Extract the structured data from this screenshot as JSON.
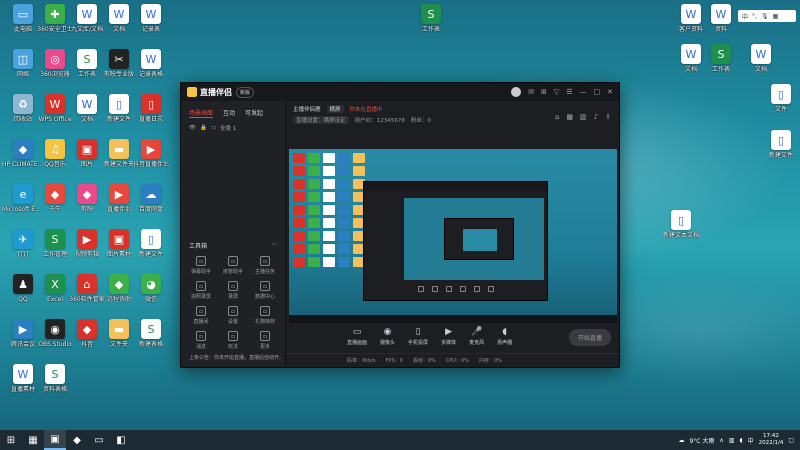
{
  "desktop": {
    "left_icons": [
      {
        "label": "此电脑",
        "icon": "computer-icon",
        "color": "#4aa3df"
      },
      {
        "label": "360安全卫士",
        "icon": "shield-icon",
        "color": "#3bb04a"
      },
      {
        "label": "九文库/文档",
        "icon": "doc-icon",
        "color": "#ffffff"
      },
      {
        "label": "文档",
        "icon": "doc-icon",
        "color": "#ffffff"
      },
      {
        "label": "记录表",
        "icon": "doc-icon",
        "color": "#ffffff"
      },
      {
        "label": "网络",
        "icon": "network-icon",
        "color": "#4aa3df"
      },
      {
        "label": "360浏览器",
        "icon": "browser-icon",
        "color": "#e84a8c"
      },
      {
        "label": "工作表",
        "icon": "sheet-icon",
        "color": "#ffffff"
      },
      {
        "label": "剪映专业版",
        "icon": "capcut-icon",
        "color": "#222222"
      },
      {
        "label": "记录表格",
        "icon": "doc-icon",
        "color": "#ffffff"
      },
      {
        "label": "回收站",
        "icon": "recycle-bin-icon",
        "color": "#8fb6cf"
      },
      {
        "label": "WPS Office",
        "icon": "wps-icon",
        "color": "#d9322b"
      },
      {
        "label": "文档",
        "icon": "doc-icon",
        "color": "#ffffff"
      },
      {
        "label": "新建文件",
        "icon": "file-icon",
        "color": "#ffffff"
      },
      {
        "label": "直播日志",
        "icon": "file-icon",
        "color": "#d9322b"
      },
      {
        "label": "HP CLIMATE User",
        "icon": "app-icon",
        "color": "#2c7fc0"
      },
      {
        "label": "QQ音乐",
        "icon": "music-icon",
        "color": "#f5c342"
      },
      {
        "label": "图片",
        "icon": "image-icon",
        "color": "#d9322b"
      },
      {
        "label": "新建文件夹",
        "icon": "folder-icon",
        "color": "#f3c05a"
      },
      {
        "label": "抖音直播伴侣",
        "icon": "live-icon",
        "color": "#e8473b"
      },
      {
        "label": "Microsoft Edge",
        "icon": "edge-icon",
        "color": "#1f9bd1"
      },
      {
        "label": "千牛",
        "icon": "app-icon",
        "color": "#e8473b"
      },
      {
        "label": "剪映",
        "icon": "app-icon",
        "color": "#e84a8c"
      },
      {
        "label": "直播伴侣",
        "icon": "live-icon",
        "color": "#e8473b"
      },
      {
        "label": "百度网盘",
        "icon": "cloud-icon",
        "color": "#2c7fc0"
      },
      {
        "label": "钉钉",
        "icon": "dingtalk-icon",
        "color": "#1f9bd1"
      },
      {
        "label": "工作管理",
        "icon": "sheet-icon",
        "color": "#1d8f4e"
      },
      {
        "label": "视频剪辑",
        "icon": "video-icon",
        "color": "#d9322b"
      },
      {
        "label": "图片素材",
        "icon": "image-icon",
        "color": "#d9322b"
      },
      {
        "label": "新建文件",
        "icon": "file-icon",
        "color": "#ffffff"
      },
      {
        "label": "QQ",
        "icon": "qq-icon",
        "color": "#222222"
      },
      {
        "label": "Excel",
        "icon": "excel-icon",
        "color": "#1d8f4e"
      },
      {
        "label": "360软件管家",
        "icon": "home-icon",
        "color": "#d9322b"
      },
      {
        "label": "远程协助",
        "icon": "app-icon",
        "color": "#3bb04a"
      },
      {
        "label": "微信",
        "icon": "wechat-icon",
        "color": "#3bb04a"
      },
      {
        "label": "腾讯会议",
        "icon": "video-icon",
        "color": "#2c7fc0"
      },
      {
        "label": "OBS Studio",
        "icon": "obs-icon",
        "color": "#222222"
      },
      {
        "label": "抖音",
        "icon": "app-icon",
        "color": "#d9322b"
      },
      {
        "label": "文件夹",
        "icon": "folder-icon",
        "color": "#f3c05a"
      },
      {
        "label": "新建表格",
        "icon": "sheet-icon",
        "color": "#ffffff"
      },
      {
        "label": "直播素材",
        "icon": "doc-icon",
        "color": "#ffffff"
      },
      {
        "label": "资料表格",
        "icon": "sheet-icon",
        "color": "#ffffff"
      }
    ],
    "right_icons": [
      {
        "label": "工作表",
        "icon": "sheet-icon",
        "color": "#1d8f4e"
      },
      {
        "label": "客户资料",
        "icon": "doc-icon",
        "color": "#ffffff"
      },
      {
        "label": "资料",
        "icon": "doc-icon",
        "color": "#ffffff"
      },
      {
        "label": "文档",
        "icon": "doc-icon",
        "color": "#ffffff"
      },
      {
        "label": "工作表",
        "icon": "sheet-icon",
        "color": "#1d8f4e"
      },
      {
        "label": "文档",
        "icon": "doc-icon",
        "color": "#ffffff"
      },
      {
        "label": "文件",
        "icon": "file-icon",
        "color": "#ffffff"
      },
      {
        "label": "新建文本文档",
        "icon": "file-icon",
        "color": "#ffffff"
      },
      {
        "label": "新建文件",
        "icon": "file-icon",
        "color": "#ffffff"
      }
    ]
  },
  "ime": {
    "label": "中"
  },
  "app": {
    "title": "直播伴侣",
    "version": "新版",
    "left_tabs": [
      "场景画面",
      "互动",
      "可发起"
    ],
    "scene_label": "全景 1",
    "tools_title": "工具箱",
    "tools": [
      {
        "label": "弹幕助手",
        "icon": "chat-icon"
      },
      {
        "label": "房管助手",
        "icon": "user-icon"
      },
      {
        "label": "主播任务",
        "icon": "task-icon"
      },
      {
        "label": "拍照录屏",
        "icon": "camera-icon"
      },
      {
        "label": "录屏",
        "icon": "record-icon"
      },
      {
        "label": "数据中心",
        "icon": "chart-icon"
      },
      {
        "label": "直播间",
        "icon": "room-icon"
      },
      {
        "label": "设置",
        "icon": "settings-icon"
      },
      {
        "label": "礼物特效",
        "icon": "gift-icon"
      },
      {
        "label": "消息",
        "icon": "message-icon"
      },
      {
        "label": "玩法",
        "icon": "game-icon"
      },
      {
        "label": "更多",
        "icon": "more-icon"
      }
    ],
    "notice": "上条公告：你未开始直播，直播后自动开。",
    "header": {
      "title": "主播伴侣鹿",
      "tag": "横屏",
      "status": "你未在直播中",
      "sub_labels": [
        "直播设置：横屏设定",
        "用户ID：12345678",
        "粉丝：0"
      ]
    },
    "controls": [
      {
        "label": "直播画面",
        "icon": "screen-icon"
      },
      {
        "label": "摄像头",
        "icon": "webcam-icon"
      },
      {
        "label": "手机投屏",
        "icon": "phone-icon"
      },
      {
        "label": "多媒体",
        "icon": "media-icon"
      },
      {
        "label": "麦克风",
        "icon": "mic-icon"
      },
      {
        "label": "扬声器",
        "icon": "speaker-icon"
      }
    ],
    "start_label": "开始直播",
    "status_items": [
      "码率：0kb/s",
      "FPS：0",
      "丢帧：0%",
      "CPU：0%",
      "内存：0%"
    ]
  },
  "taskbar": {
    "weather": "9°C 大雨",
    "time": "17:42",
    "date": "2022/1/4"
  }
}
